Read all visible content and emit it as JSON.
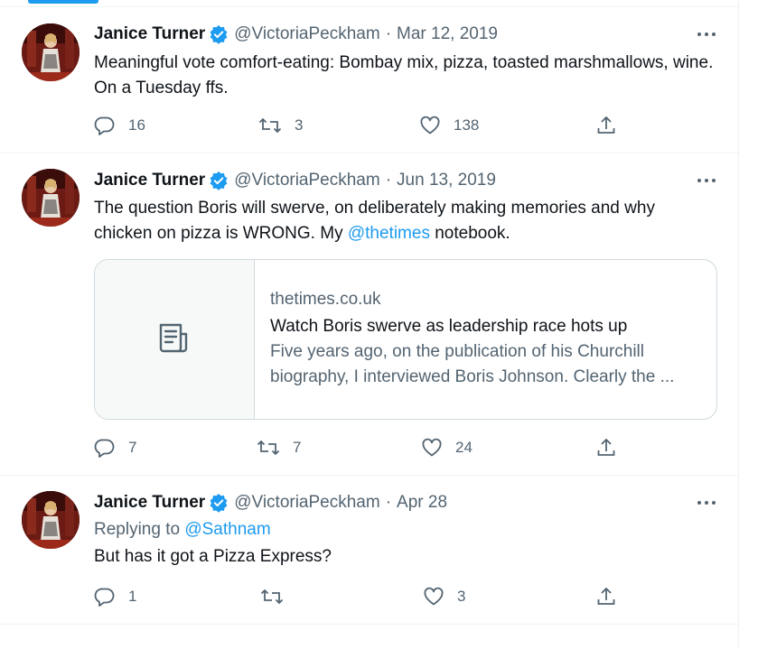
{
  "tweets": [
    {
      "name": "Janice Turner",
      "handle": "@VictoriaPeckham",
      "separator": "·",
      "date": "Mar 12, 2019",
      "text": "Meaningful vote comfort-eating: Bombay mix, pizza, toasted marshmallows, wine. On a Tuesday  ffs.",
      "replies": "16",
      "retweets": "3",
      "likes": "138"
    },
    {
      "name": "Janice Turner",
      "handle": "@VictoriaPeckham",
      "separator": "·",
      "date": "Jun 13, 2019",
      "text_before": "The question Boris will swerve, on deliberately making memories and why chicken on pizza is WRONG. My ",
      "mention": "@thetimes",
      "text_after": " notebook.",
      "card": {
        "domain": "thetimes.co.uk",
        "title": "Watch Boris swerve as leadership race hots up",
        "description_line1": "Five years ago, on the publication of his Churchill",
        "description_line2": "biography, I interviewed Boris Johnson. Clearly the ..."
      },
      "replies": "7",
      "retweets": "7",
      "likes": "24"
    },
    {
      "name": "Janice Turner",
      "handle": "@VictoriaPeckham",
      "separator": "·",
      "date": "Apr 28",
      "replying_label": "Replying to ",
      "replying_to": "@Sathnam",
      "text": "But has it got a Pizza Express?",
      "replies": "1",
      "retweets": "",
      "likes": "3"
    }
  ],
  "colors": {
    "accent": "#1d9bf0",
    "text": "#0f1419",
    "secondary": "#536471",
    "border": "#eff3f4"
  },
  "icons": [
    "verified-badge-icon",
    "more-icon",
    "reply-icon",
    "retweet-icon",
    "like-icon",
    "share-icon",
    "article-icon"
  ]
}
